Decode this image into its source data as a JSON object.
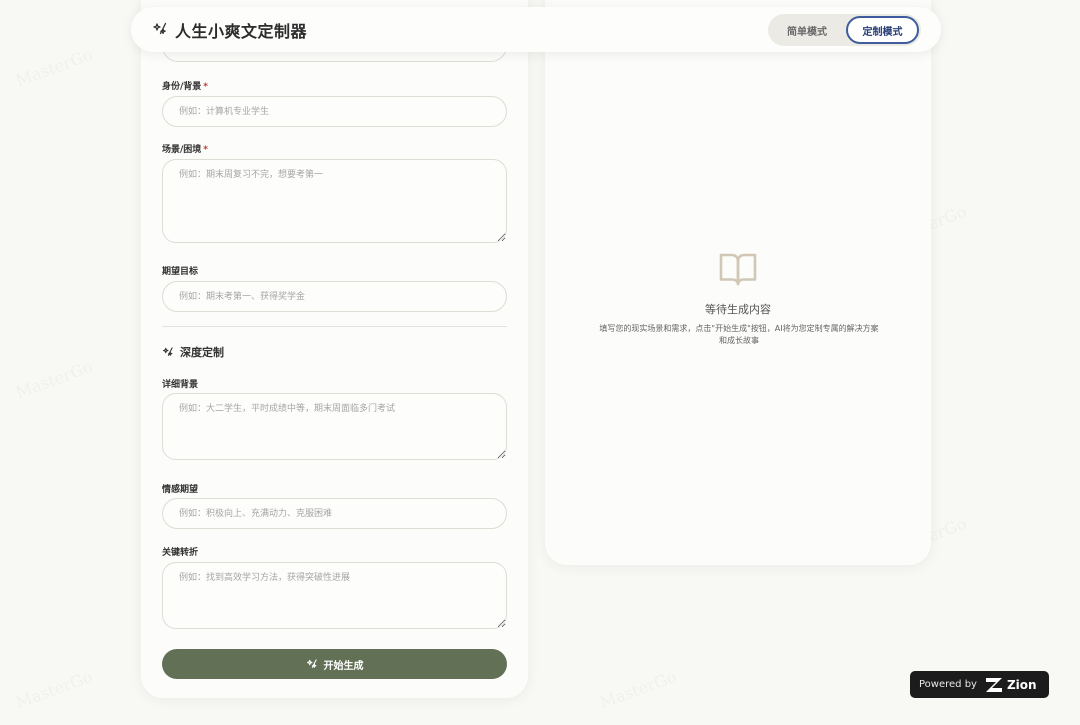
{
  "app": {
    "title": "人生小爽文定制器"
  },
  "mode_toggle": {
    "simple_label": "简单模式",
    "custom_label": "定制模式",
    "active": "custom"
  },
  "form": {
    "identity": {
      "label": "身份/背景",
      "required_mark": "*",
      "placeholder": "例如：计算机专业学生"
    },
    "scenario": {
      "label": "场景/困境",
      "required_mark": "*",
      "placeholder": "例如：期末周复习不完，想要考第一"
    },
    "goal": {
      "label": "期望目标",
      "placeholder": "例如：期末考第一、获得奖学金"
    },
    "deep_section": {
      "title": "深度定制"
    },
    "detail_background": {
      "label": "详细背景",
      "placeholder": "例如：大二学生，平时成绩中等，期末周面临多门考试"
    },
    "emotion": {
      "label": "情感期望",
      "placeholder": "例如：积极向上、充满动力、克服困难"
    },
    "turning_point": {
      "label": "关键转折",
      "placeholder": "例如：找到高效学习方法，获得突破性进展"
    },
    "generate_label": "开始生成"
  },
  "output": {
    "waiting_title": "等待生成内容",
    "waiting_desc": "填写您的现实场景和需求，点击\"开始生成\"按钮，AI将为您定制专属的解决方案和成长故事"
  },
  "badge": {
    "powered_by": "Powered by",
    "brand": "Zion"
  },
  "watermark": "MasterGo",
  "colors": {
    "primary": "#627055",
    "accent_border": "#3f5d9c",
    "background": "#f8f8f5"
  }
}
